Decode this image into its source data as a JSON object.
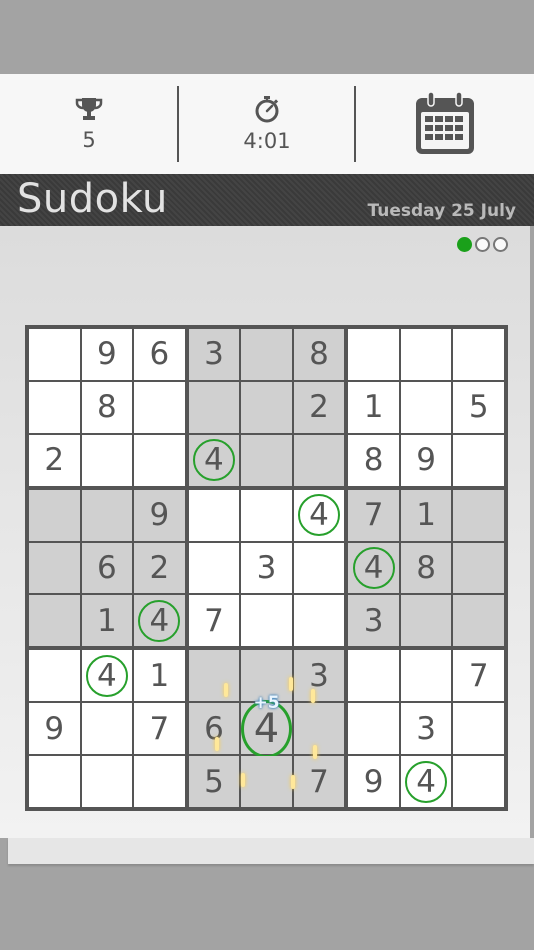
{
  "stats": {
    "best": "5",
    "timer": "4:01"
  },
  "header": {
    "title": "Sudoku",
    "date": "Tuesday 25 July"
  },
  "pager": {
    "count": 3,
    "active": 0
  },
  "colors": {
    "accent": "#1aa01a",
    "ring": "#27a02c",
    "header_bg": "#3a3a3a"
  },
  "board": {
    "rows": [
      [
        0,
        9,
        6,
        3,
        0,
        8,
        0,
        0,
        0
      ],
      [
        0,
        8,
        0,
        0,
        0,
        2,
        1,
        0,
        5
      ],
      [
        2,
        0,
        0,
        4,
        0,
        0,
        8,
        9,
        0
      ],
      [
        0,
        0,
        9,
        0,
        0,
        4,
        7,
        1,
        0
      ],
      [
        0,
        6,
        2,
        0,
        3,
        0,
        4,
        8,
        0
      ],
      [
        0,
        1,
        4,
        7,
        0,
        0,
        3,
        0,
        0
      ],
      [
        0,
        4,
        1,
        0,
        0,
        3,
        0,
        0,
        7
      ],
      [
        9,
        0,
        7,
        6,
        4,
        0,
        0,
        3,
        0
      ],
      [
        0,
        0,
        0,
        5,
        0,
        7,
        9,
        4,
        0
      ]
    ],
    "shaded": [
      [
        0,
        0,
        0,
        1,
        1,
        1,
        0,
        0,
        0
      ],
      [
        0,
        0,
        0,
        1,
        1,
        1,
        0,
        0,
        0
      ],
      [
        0,
        0,
        0,
        1,
        1,
        1,
        0,
        0,
        0
      ],
      [
        1,
        1,
        1,
        0,
        0,
        0,
        1,
        1,
        1
      ],
      [
        1,
        1,
        1,
        0,
        0,
        0,
        1,
        1,
        1
      ],
      [
        1,
        1,
        1,
        0,
        0,
        0,
        1,
        1,
        1
      ],
      [
        0,
        0,
        0,
        1,
        1,
        1,
        0,
        0,
        0
      ],
      [
        0,
        0,
        0,
        1,
        1,
        1,
        0,
        0,
        0
      ],
      [
        0,
        0,
        0,
        1,
        1,
        1,
        0,
        0,
        0
      ]
    ],
    "circled": [
      [
        2,
        3
      ],
      [
        3,
        5
      ],
      [
        4,
        6
      ],
      [
        5,
        2
      ],
      [
        6,
        1
      ],
      [
        8,
        7
      ]
    ],
    "placed": [
      7,
      4
    ],
    "bonus_text": "+5"
  }
}
